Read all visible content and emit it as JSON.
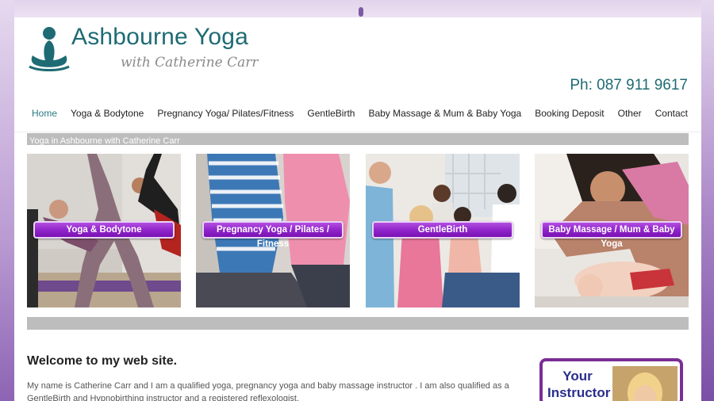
{
  "header": {
    "logo_title": "Ashbourne Yoga",
    "logo_subtitle": "with Catherine Carr",
    "phone": "Ph: 087 911 9617"
  },
  "nav": [
    {
      "label": "Home",
      "active": true
    },
    {
      "label": "Yoga & Bodytone",
      "active": false
    },
    {
      "label": "Pregnancy Yoga/ Pilates/Fitness",
      "active": false
    },
    {
      "label": "GentleBirth",
      "active": false
    },
    {
      "label": "Baby Massage & Mum & Baby Yoga",
      "active": false
    },
    {
      "label": "Booking Deposit",
      "active": false
    },
    {
      "label": "Other",
      "active": false
    },
    {
      "label": "Contact",
      "active": false
    }
  ],
  "banner_text": "Yoga in Ashbourne with Catherine Carr",
  "tiles": [
    {
      "label": "Yoga & Bodytone"
    },
    {
      "label": "Pregnancy Yoga / Pilates / Fitness"
    },
    {
      "label": "GentleBirth"
    },
    {
      "label": "Baby Massage / Mum & Baby Yoga"
    }
  ],
  "content": {
    "heading": "Welcome to my web site.",
    "intro": "My name is Catherine Carr and I am a qualified yoga, pregnancy yoga and baby massage instructor .   I am also qualified as a GentleBirth and Hypnobirthing  instructor and a registered reflexologist."
  },
  "sidebar": {
    "instructor_label_1": "Your",
    "instructor_label_2": "Instructor"
  },
  "colors": {
    "brand_teal": "#1e6b74",
    "button_purple": "#8e23c9",
    "banner_grey": "#bdbdbd",
    "frame_purple": "#7a2e95"
  }
}
